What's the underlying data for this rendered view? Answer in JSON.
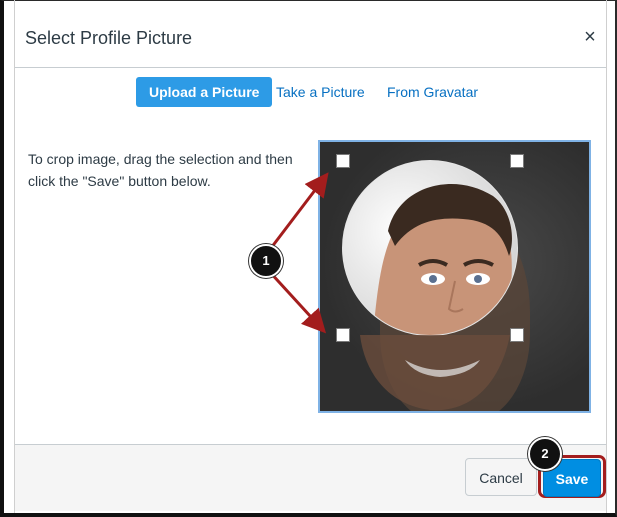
{
  "dialog": {
    "title": "Select Profile Picture",
    "close_glyph": "×"
  },
  "tabs": [
    {
      "label": "Upload a Picture",
      "active": true
    },
    {
      "label": "Take a Picture",
      "active": false
    },
    {
      "label": "From Gravatar",
      "active": false
    }
  ],
  "instructions": "To crop image, drag the selection and then click the \"Save\" button below.",
  "footer": {
    "cancel_label": "Cancel",
    "save_label": "Save"
  },
  "annotations": {
    "marker_1": "1",
    "marker_2": "2"
  },
  "colors": {
    "accent": "#008ee2",
    "active_tab": "#2d9be6",
    "link": "#0770c2",
    "annotation": "#a31d1d"
  }
}
